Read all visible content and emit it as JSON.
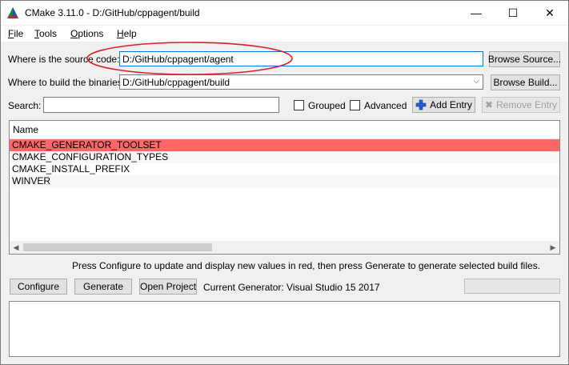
{
  "window": {
    "title": "CMake 3.11.0 - D:/GitHub/cppagent/build",
    "minimize_glyph": "—",
    "maximize_glyph": "☐",
    "close_glyph": "✕"
  },
  "menu": {
    "file": {
      "mnemonic": "F",
      "rest": "ile"
    },
    "tools": {
      "mnemonic": "T",
      "rest": "ools"
    },
    "options": {
      "mnemonic": "O",
      "rest": "ptions"
    },
    "help": {
      "mnemonic": "H",
      "rest": "elp"
    }
  },
  "source": {
    "label": "Where is the source code:",
    "value": "D:/GitHub/cppagent/agent",
    "browse_label": "Browse Source..."
  },
  "build": {
    "label": "Where to build the binaries:",
    "value": "D:/GitHub/cppagent/build",
    "browse_label": "Browse Build..."
  },
  "search": {
    "label": "Search:",
    "value": ""
  },
  "options": {
    "grouped_label": "Grouped",
    "advanced_label": "Advanced",
    "add_entry_label": "Add Entry",
    "remove_entry_label": "Remove Entry"
  },
  "table": {
    "column_header": "Name",
    "rows": [
      {
        "name": "CMAKE_GENERATOR_TOOLSET",
        "selected": true
      },
      {
        "name": "CMAKE_CONFIGURATION_TYPES",
        "selected": false
      },
      {
        "name": "CMAKE_INSTALL_PREFIX",
        "selected": false
      },
      {
        "name": "WINVER",
        "selected": false
      }
    ]
  },
  "hint": "Press Configure to update and display new values in red, then press Generate to generate selected build files.",
  "actions": {
    "configure_label": "Configure",
    "generate_label": "Generate",
    "open_project_label": "Open Project",
    "current_generator": "Current Generator: Visual Studio 15 2017"
  },
  "colors": {
    "selected_row": "#ff6666",
    "annotation": "#d9202a",
    "focus_border": "#0078d7"
  }
}
